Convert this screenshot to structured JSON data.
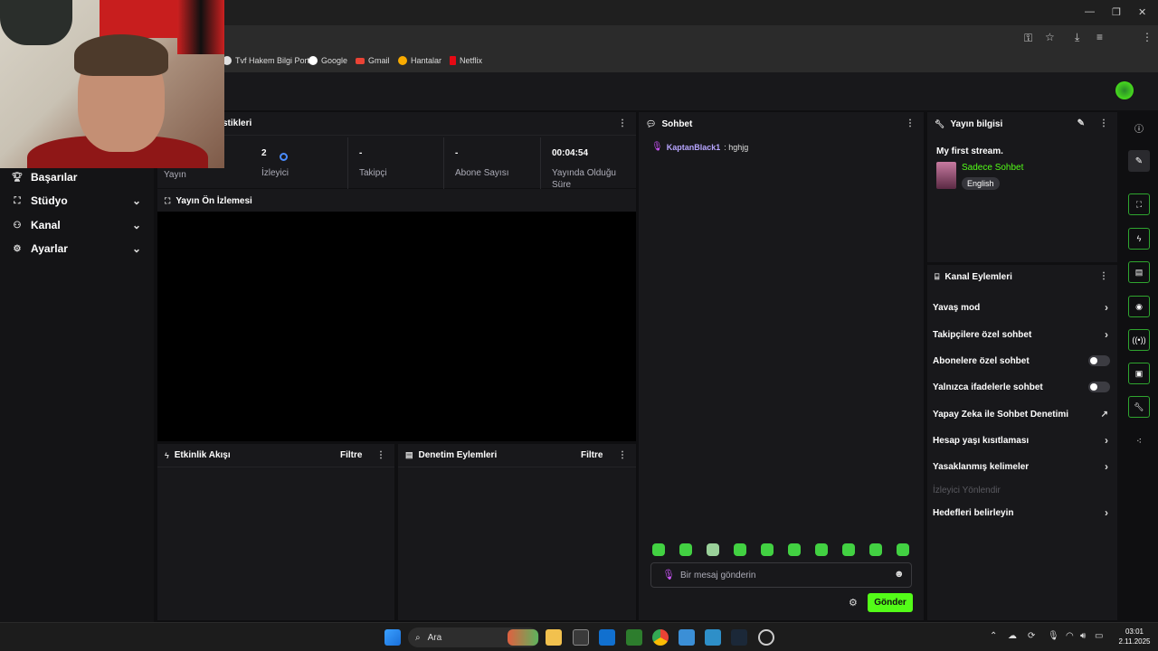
{
  "browser": {
    "bookmarks": [
      {
        "label": "Tvf Hakem Bilgi Port...",
        "color": "#e0e0e0"
      },
      {
        "label": "Google",
        "color": "#ffffff"
      },
      {
        "label": "Gmail",
        "color": "#ea4335"
      },
      {
        "label": "Hantalar",
        "color": "#f9ab00"
      },
      {
        "label": "Netflix",
        "color": "#e50914"
      }
    ]
  },
  "sidebar": {
    "items": [
      {
        "label": "Başarılar",
        "icon": "trophy-icon"
      },
      {
        "label": "Stüdyo",
        "icon": "studio-icon"
      },
      {
        "label": "Kanal",
        "icon": "channel-icon"
      },
      {
        "label": "Ayarlar",
        "icon": "gear-icon"
      }
    ]
  },
  "stats": {
    "header_partial": "stikleri",
    "items": [
      {
        "value": "",
        "label": "Yayın"
      },
      {
        "value": "2",
        "label": "İzleyici"
      },
      {
        "value": "-",
        "label": "Takipçi"
      },
      {
        "value": "-",
        "label": "Abone Sayısı"
      },
      {
        "value": "00:04:54",
        "label": "Yayında Olduğu Süre"
      }
    ]
  },
  "preview": {
    "title": "Yayın Ön İzlemesi"
  },
  "activity": {
    "title": "Etkinlik Akışı",
    "filter": "Filtre"
  },
  "moderation": {
    "title": "Denetim Eylemleri",
    "filter": "Filtre"
  },
  "chat": {
    "title": "Sohbet",
    "messages": [
      {
        "user": "KaptanBlack1",
        "text": ": hghjg"
      }
    ],
    "placeholder": "Bir mesaj gönderin",
    "send_label": "Gönder"
  },
  "stream_info": {
    "title": "Yayın bilgisi",
    "stream_title": "My first stream.",
    "category": "Sadece Sohbet",
    "language": "English"
  },
  "channel_actions": {
    "title": "Kanal Eylemleri",
    "items": [
      {
        "label": "Yavaş mod",
        "control": "chevron"
      },
      {
        "label": "Takipçilere özel sohbet",
        "control": "chevron"
      },
      {
        "label": "Abonelere özel sohbet",
        "control": "toggle",
        "on": false
      },
      {
        "label": "Yalnızca ifadelerle sohbet",
        "control": "toggle",
        "on": false
      },
      {
        "label": "Yapay Zeka ile Sohbet Denetimi",
        "control": "external"
      },
      {
        "label": "Hesap yaşı kısıtlaması",
        "control": "chevron"
      },
      {
        "label": "Yasaklanmış kelimeler",
        "control": "chevron"
      },
      {
        "label": "İzleyici Yönlendir",
        "control": "disabled"
      },
      {
        "label": "Hedefleri belirleyin",
        "control": "chevron"
      }
    ]
  },
  "taskbar": {
    "search_label": "Ara",
    "time": "03:01",
    "date": "2.11.2025"
  },
  "colors": {
    "accent": "#53fc18",
    "panel": "#18181b",
    "background": "#0f0f11"
  }
}
